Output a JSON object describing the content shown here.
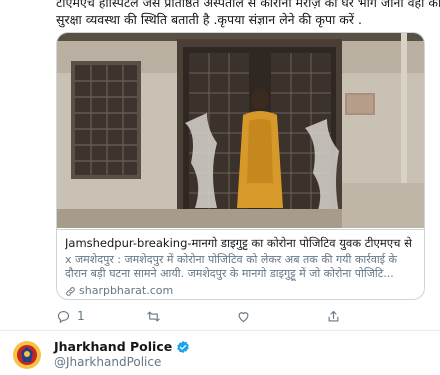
{
  "tweet": {
    "text_line1": "टीएमएच हॉस्पिटल जैसे प्रतिष्ठित अस्पताल से कोरोना मरीज़ का घर भाग जाना वहां की",
    "text_line2": "सुरक्षा व्यवस्था की स्थिति बताती है .कृपया संज्ञान लेने की कृपा करें ."
  },
  "card": {
    "title": "Jamshedpur-breaking-मानगो डाइगुट्टू का कोरोना पोजिटिव युवक टीएमएच से ...",
    "description": "x जमशेदपुर : जमशेदपुर में कोरोना पोजिटिव को लेकर अब तक की गयी कार्रवाई के दौरान बड़ी घटना सामने आयी. जमशेदपुर के मानगो डाइगुट्टू में जो कोरोना पोजिटि...",
    "domain": "sharpbharat.com"
  },
  "actions": {
    "reply_count": "1",
    "retweet_count": "",
    "like_count": ""
  },
  "next_tweet": {
    "display_name": "Jharkhand Police",
    "handle": "@JharkhandPolice"
  },
  "colors": {
    "text": "#14171a",
    "secondary": "#657786",
    "border": "#ccd6dd",
    "verified": "#1da1f2"
  },
  "icons": {
    "reply": "reply-icon",
    "retweet": "retweet-icon",
    "like": "heart-icon",
    "share": "share-icon",
    "link": "link-icon",
    "verified": "verified-badge-icon"
  }
}
